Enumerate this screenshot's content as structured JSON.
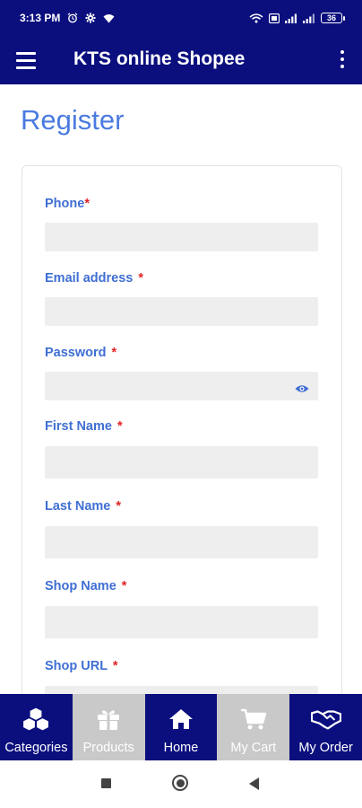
{
  "status_bar": {
    "time": "3:13 PM",
    "battery": "36"
  },
  "app_bar": {
    "title": "KTS online Shopee",
    "menu_icon": "hamburger-menu-icon",
    "more_icon": "more-vert-icon"
  },
  "page": {
    "title": "Register"
  },
  "form": {
    "required_marker": "*",
    "fields": [
      {
        "label": "Phone",
        "value": "",
        "placeholder": ""
      },
      {
        "label": "Email address ",
        "value": "",
        "placeholder": ""
      },
      {
        "label": "Password ",
        "value": "",
        "placeholder": ""
      },
      {
        "label": "First Name ",
        "value": "",
        "placeholder": ""
      },
      {
        "label": "Last Name ",
        "value": "",
        "placeholder": ""
      },
      {
        "label": "Shop Name ",
        "value": "",
        "placeholder": ""
      },
      {
        "label": "Shop URL ",
        "value": "",
        "placeholder": ""
      }
    ]
  },
  "bottom_nav": {
    "items": [
      {
        "label": "Categories",
        "icon": "cubes-icon",
        "active": true
      },
      {
        "label": "Products",
        "icon": "gift-icon",
        "active": false
      },
      {
        "label": "Home",
        "icon": "home-icon",
        "active": true
      },
      {
        "label": "My Cart",
        "icon": "cart-icon",
        "active": false
      },
      {
        "label": "My Order",
        "icon": "handshake-icon",
        "active": true
      }
    ]
  },
  "colors": {
    "primary": "#0b0f7e",
    "accent": "#4a7be0",
    "label": "#3f6fd3",
    "required": "#e02424",
    "inactive_tab": "#c9c9c9",
    "input_bg": "#eeeeee"
  }
}
